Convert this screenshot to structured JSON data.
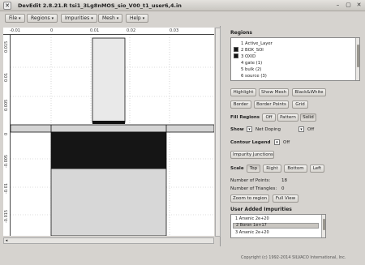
{
  "window": {
    "title": "DevEdit 2.8.21.R tsi1_3Lg8nMOS_sio_V00_t1_user6,4.in",
    "controls": [
      "–",
      "▢",
      "✕"
    ]
  },
  "menubar": [
    "File",
    "Regions",
    "Impurities",
    "Mesh",
    "Help"
  ],
  "plot": {
    "x_ticks": [
      "-0.01",
      "0",
      "0.01",
      "0.02",
      "0.03"
    ],
    "y_ticks": [
      "0.015",
      "0.01",
      "0.005",
      "0",
      "-0.005",
      "-0.01",
      "-0.015"
    ],
    "colors": {
      "oxide": "#e4e4e4",
      "box": "#151515",
      "bulk": "#d7d7d7",
      "outline": "#111111"
    }
  },
  "regions_panel": {
    "title": "Regions",
    "items": [
      {
        "label": "1 Active_Layer",
        "color": ""
      },
      {
        "label": "2 BOX_SOI",
        "color": "#151515"
      },
      {
        "label": "3 OXID",
        "color": "#151515"
      },
      {
        "label": "4 gate (1)",
        "color": ""
      },
      {
        "label": "5 bulk (2)",
        "color": ""
      },
      {
        "label": "6 source (3)",
        "color": ""
      }
    ],
    "buttons_row1": [
      "Highlight",
      "Show Mesh",
      "Black&White"
    ],
    "buttons_row2": [
      "Border",
      "Border Points",
      "Grid"
    ],
    "fill_label": "Fill Regions",
    "fill_options": [
      "Off",
      "Pattern",
      "Solid"
    ],
    "fill_selected": "Solid",
    "show_label": "Show",
    "show_value": "Net Doping",
    "show_off": "Off",
    "contour_label": "Contour Legend",
    "contour_off": "Off",
    "impurity_junctions": "Impurity Junctions",
    "scale_label": "Scale",
    "scale_options": [
      "Top",
      "Right",
      "Bottom",
      "Left"
    ],
    "points_label": "Number of Points:",
    "points_value": "18",
    "triangles_label": "Number of Triangles:",
    "triangles_value": "0",
    "zoom_button": "Zoom to region",
    "fullview_button": "Full View"
  },
  "impurities_panel": {
    "title": "User Added Impurities",
    "items": [
      {
        "label": "1 Arsenic  2e+20",
        "selected": false
      },
      {
        "label": "2 Boron  1e+17",
        "selected": true
      },
      {
        "label": "3 Arsenic  2e+20",
        "selected": false
      }
    ]
  },
  "footer": {
    "copyright": "Copyright (c) 1992-2014 SILVACO International, Inc."
  }
}
